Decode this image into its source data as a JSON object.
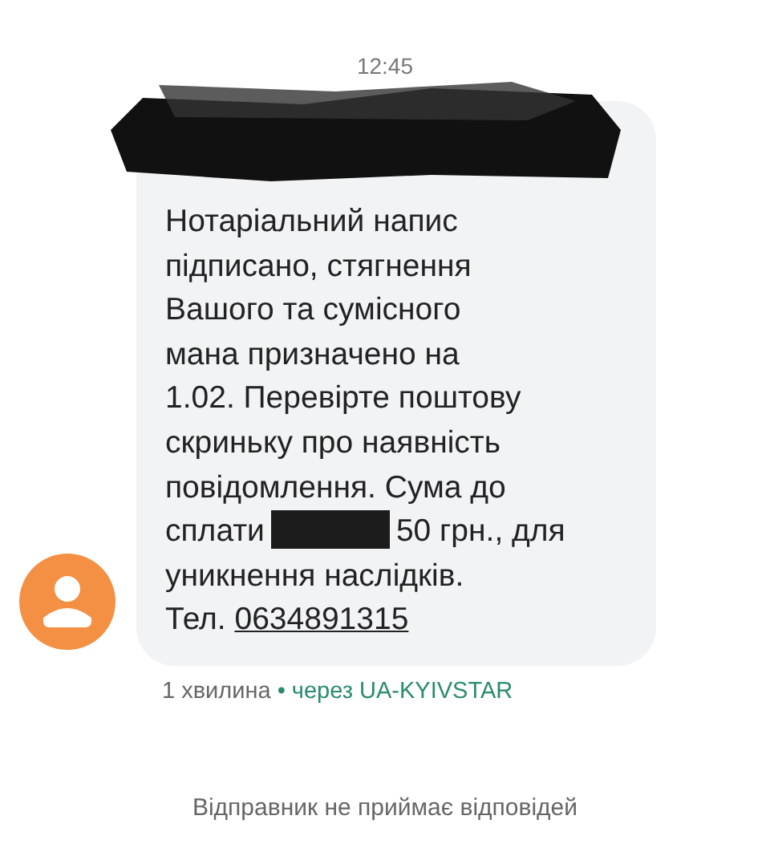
{
  "time": "12:45",
  "message": {
    "redacted_header": true,
    "lines": [
      {
        "segments": [
          {
            "kind": "text",
            "text": "Нотаріальний напис"
          }
        ]
      },
      {
        "segments": [
          {
            "kind": "text",
            "text": "підписано, стягнення"
          }
        ]
      },
      {
        "segments": [
          {
            "kind": "text",
            "text": "Вашого та сумісного"
          }
        ]
      },
      {
        "segments": [
          {
            "kind": "text",
            "text": "мана призначено на"
          }
        ]
      },
      {
        "segments": [
          {
            "kind": "text",
            "text": "1.02. Перевірте поштову"
          }
        ]
      },
      {
        "segments": [
          {
            "kind": "text",
            "text": "скриньку про наявність"
          }
        ]
      },
      {
        "segments": [
          {
            "kind": "text",
            "text": "повідомлення. Сума до"
          }
        ]
      },
      {
        "segments": [
          {
            "kind": "text",
            "text": "сплати"
          },
          {
            "kind": "redacted"
          },
          {
            "kind": "text",
            "text": "50 грн., для"
          }
        ]
      },
      {
        "segments": [
          {
            "kind": "text",
            "text": "уникнення наслідків."
          }
        ]
      },
      {
        "segments": [
          {
            "kind": "text",
            "text": "Тел. "
          },
          {
            "kind": "link",
            "text": "0634891315"
          }
        ]
      }
    ]
  },
  "meta": {
    "age": "1 хвилина",
    "separator": "•",
    "via": "через UA-KYIVSTAR"
  },
  "footer": "Відправник не приймає відповідей"
}
